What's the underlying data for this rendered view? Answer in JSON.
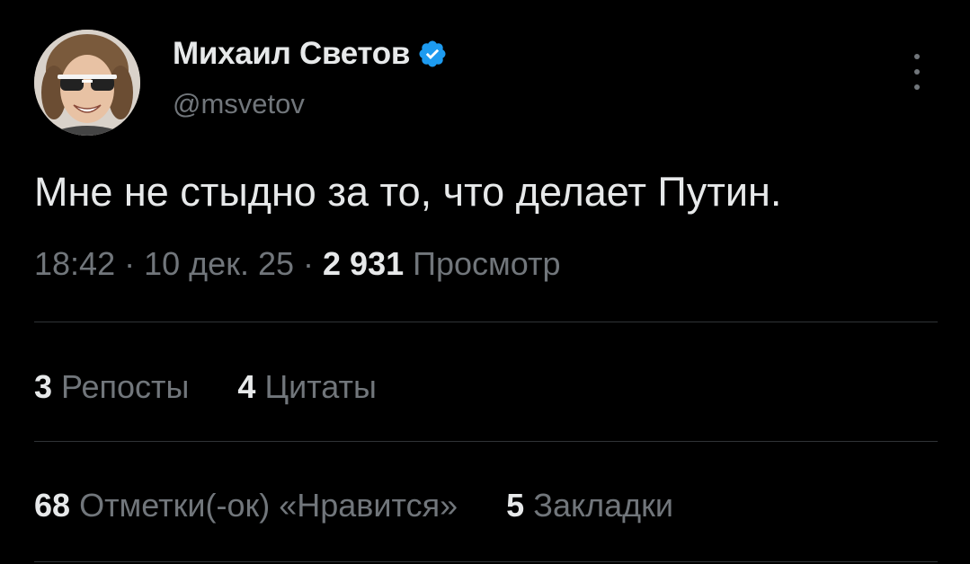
{
  "author": {
    "display_name": "Михаил Светов",
    "handle": "@msvetov",
    "verified_icon": "verified-badge-icon",
    "accent_color": "#1d9bf0"
  },
  "tweet": {
    "text": "Мне не стыдно за то, что делает Путин.",
    "time": "18:42",
    "date": "10 дек. 25",
    "separator": "·",
    "views_count": "2 931",
    "views_label": "Просмотр"
  },
  "stats_row1": {
    "reposts_count": "3",
    "reposts_label": "Репосты",
    "quotes_count": "4",
    "quotes_label": "Цитаты"
  },
  "stats_row2": {
    "likes_count": "68",
    "likes_label": "Отметки(-ок) «Нравится»",
    "bookmarks_count": "5",
    "bookmarks_label": "Закладки"
  }
}
